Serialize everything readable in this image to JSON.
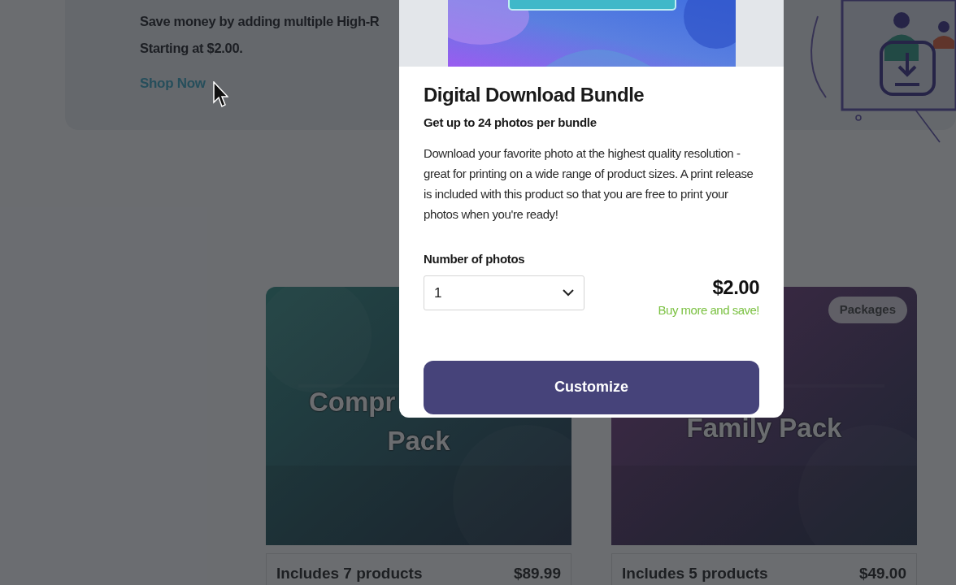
{
  "banner": {
    "lines": [
      "Save money by adding multiple High-R",
      "Starting at $2.00."
    ],
    "link": "Shop Now"
  },
  "cards": [
    {
      "title_lines": [
        "Compr",
        "Pack"
      ],
      "footer_left": "Includes 7 products",
      "footer_right": "$89.99"
    },
    {
      "badge": "Packages",
      "title_lines": [
        "Family Pack"
      ],
      "footer_left": "Includes 5 products",
      "footer_right": "$49.00"
    }
  ],
  "modal": {
    "title": "Digital Download Bundle",
    "subtitle": "Get up to 24 photos per bundle",
    "description": "Download your favorite photo at the highest quality resolution - great for printing on a wide range of product sizes. A print release is included with this product so that you are free to print your photos when you're ready!",
    "quantity": {
      "label": "Number of photos",
      "value": "1"
    },
    "price": "$2.00",
    "price_note": "Buy more and save!",
    "button": "Customize"
  }
}
